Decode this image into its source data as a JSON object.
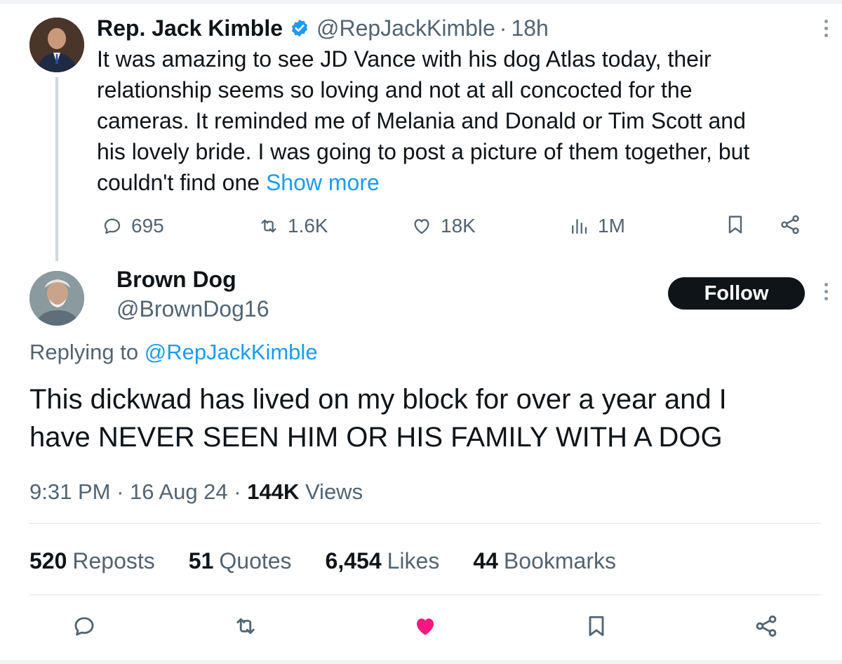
{
  "parent_tweet": {
    "author_name": "Rep. Jack Kimble",
    "handle": "@RepJackKimble",
    "separator": "·",
    "time": "18h",
    "body_lines": [
      "It was amazing to see JD Vance with his dog Atlas today, their",
      "relationship seems so loving and not at all concocted for the",
      "cameras. It reminded me of  Melania and Donald or Tim Scott and",
      "his lovely bride. I was going to post a picture of them together, but",
      "couldn't find one "
    ],
    "show_more": "Show more",
    "actions": {
      "replies": "695",
      "reposts": "1.6K",
      "likes": "18K",
      "views": "1M"
    },
    "icons": [
      "verified-badge-icon",
      "reply-icon",
      "repost-icon",
      "heart-icon",
      "views-icon",
      "bookmark-icon",
      "share-icon",
      "more-icon"
    ]
  },
  "reply_tweet": {
    "author_name": "Brown Dog",
    "handle": "@BrownDog16",
    "follow_label": "Follow",
    "replying_prefix": "Replying to ",
    "replying_to": "@RepJackKimble",
    "body_lines": [
      "This dickwad has lived on my block for over a year and I",
      "have NEVER SEEN HIM OR HIS FAMILY WITH A DOG"
    ],
    "time": "9:31 PM",
    "sep1": " · ",
    "date": "16 Aug 24",
    "sep2": " · ",
    "views_count": "144K",
    "views_label": " Views",
    "stats": {
      "reposts": {
        "num": "520",
        "label": "Reposts"
      },
      "quotes": {
        "num": "51",
        "label": "Quotes"
      },
      "likes": {
        "num": "6,454",
        "label": "Likes"
      },
      "bookmarks": {
        "num": "44",
        "label": "Bookmarks"
      }
    }
  },
  "colors": {
    "accent": "#1d9bf0",
    "text": "#0f1419",
    "muted": "#536471",
    "like_active": "#f91880",
    "follow_bg": "#0f1419"
  }
}
